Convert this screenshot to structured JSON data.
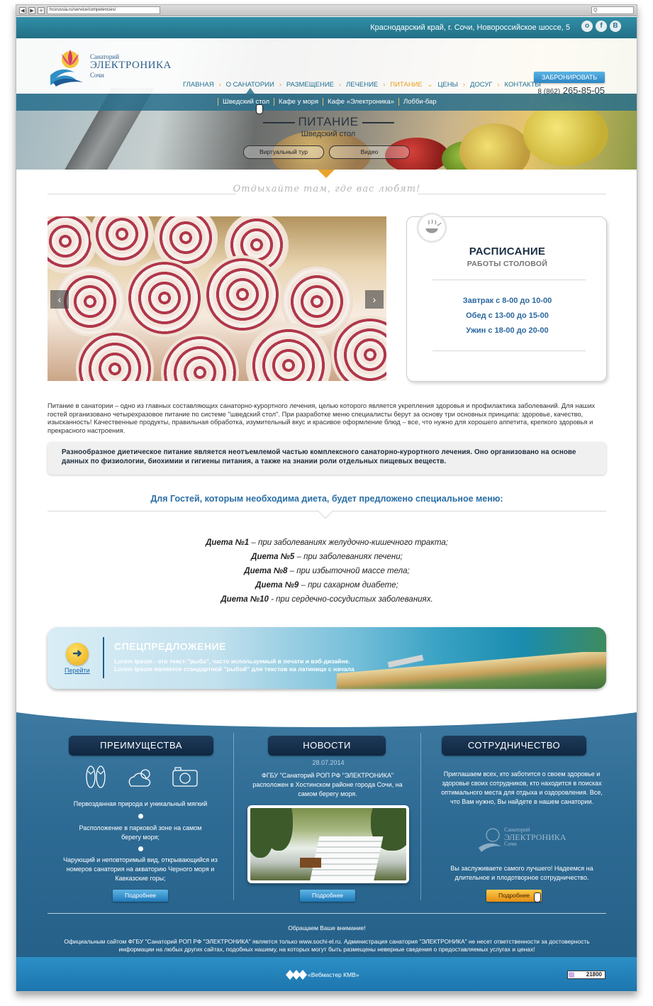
{
  "browser": {
    "url": "hcsrussia.ru/service/competencies/",
    "back_label": "◀",
    "forward_label": "▶",
    "reload_label": "+",
    "search_placeholder": "Q"
  },
  "topbar": {
    "address": "Краснодарский край, г. Сочи, Новороссийское шоссе, 5",
    "social": [
      "о",
      "f",
      "B"
    ]
  },
  "logo": {
    "line1": "Санаторий",
    "line2": "ЭЛЕКТРОНИКА",
    "line3": "Сочи"
  },
  "nav": {
    "items": [
      "ГЛАВНАЯ",
      "О САНАТОРИИ",
      "РАЗМЕЩЕНИЕ",
      "ЛЕЧЕНИЕ",
      "ПИТАНИЕ",
      "ЦЕНЫ",
      "ДОСУГ",
      "КОНТАКТЫ"
    ],
    "active": "ПИТАНИЕ",
    "book_label": "ЗАБРОНИРОВАТЬ",
    "phone_prefix": "8 (862)",
    "phone_number": "265-85-05"
  },
  "subnav": {
    "items": [
      "Шведский стол",
      "Кафе у моря",
      "Кафе «Электроника»",
      "Лобби-бар"
    ]
  },
  "hero": {
    "title": "ПИТАНИЕ",
    "subtitle": "Шведский стол",
    "btn_tour": "Виртуальный тур",
    "btn_video": "Видео"
  },
  "tagline": "Отдыхайте там, где вас любят!",
  "slider": {
    "prev_label": "‹",
    "next_label": "›"
  },
  "schedule": {
    "title": "РАСПИСАНИЕ",
    "subtitle": "РАБОТЫ СТОЛОВОЙ",
    "lines": [
      "Завтрак с 8-00 до 10-00",
      "Обед с 13-00 до 15-00",
      "Ужин с 18-00 до 20-00"
    ]
  },
  "intro": "Питание в санатории – одно из главных составляющих санаторно-курортного лечения, целью которого является укрепления здоровья и профилактика заболеваний. Для наших гостей организовано четырехразовое питание по системе \"шведский стол\". При разработке меню специалисты берут за основу три основных принципа: здоровье, качество, изысканность!  Качественные продукты, правильная обработка, изумительный вкус и красивое оформление блюд – все, что нужно для хорошего аппетита, крепкого здоровья и прекрасного настроения.",
  "highlight": "Разнообразное диетическое питание является неотъемлемой частью комплексного санаторно-курортного лечения. Оно организовано на основе данных по физиологии, биохимии и гигиены питания, а также на знании роли отдельных пищевых веществ.",
  "diet": {
    "heading": "Для Гостей, которым необходима диета, будет предложено специальное меню:",
    "items": [
      {
        "name": "Диета №1",
        "desc": " – при заболеваниях желудочно-кишечного тракта;"
      },
      {
        "name": "Диета №5",
        "desc": " – при заболеваниях печени;"
      },
      {
        "name": "Диета №8",
        "desc": " – при избыточной массе тела;"
      },
      {
        "name": "Диета №9",
        "desc": " – при сахарном диабете;"
      },
      {
        "name": "Диета №10",
        "desc": " -  при сердечно-сосудистых заболеваниях."
      }
    ]
  },
  "offer": {
    "title": "СПЕЦПРЕДЛОЖЕНИЕ",
    "link": "Перейти",
    "text1": "Lorem Ipsum - это текст-\"рыба\", часто используемый в печати и вэб-дизайне.",
    "text2": "Lorem Ipsum является стандартной \"рыбой\" для текстов на латинице с начала"
  },
  "advantages": {
    "title": "ПРЕИМУЩЕСТВА",
    "p1": "Первозданная природа и уникальный мягкий",
    "p2a": "Расположение в парковой зоне на самом",
    "p2b": "берегу моря;",
    "p3a": "Чарующий и неповторимый вид, открывающийся из",
    "p3b": "номеров санатория на акваторию Черного моря и",
    "p3c": "Кавказские горы;",
    "button": "Подробнее"
  },
  "news": {
    "title": "НОВОСТИ",
    "date": "28.07.2014",
    "line1": "ФГБУ \"Санаторий РОП РФ \"ЭЛЕКТРОНИКА\"",
    "line2": "расположен в Хостинском районе города Сочи, на",
    "line3": "самом берегу моря.",
    "button": "Подробнее"
  },
  "coop": {
    "title": "СОТРУДНИЧЕСТВО",
    "line1": "Приглашаем всех, кто заботится о своем здоровье и",
    "line2": "здоровье своих сотрудников, кто находится в поисках",
    "line3": "оптимального места для отдыха и оздоровления. Все,",
    "line4": "что Вам нужно, Вы найдете в нашем санатории.",
    "line5": "Вы заслуживаете самого лучшего! Надеемся на",
    "line6": "длительное и плодотворное сотрудничество.",
    "logo1": "Санаторий",
    "logo2": "ЭЛЕКТРОНИКА",
    "logo3": "Сочи",
    "button": "Подробнее"
  },
  "notice": {
    "line1": "Обращаем Ваше внимание!",
    "line2": "Официальным сайтом ФГБУ \"Санаторий РОП РФ \"ЭЛЕКТРОНИКА\" является только www.sochi-el.ru. Администрация санатория \"ЭЛЕКТРОНИКА\" не несет ответственности за достоверность",
    "line3": "информации на любых других сайтах, подобных нашему, на которых могут быть размещены неверные сведения о предоставляемых услугах и ценах!"
  },
  "bottom": {
    "webmaster": "«Вебмастер КМВ»",
    "counter": "21800"
  },
  "colors": {
    "accent_orange": "#e6a020",
    "brand_blue": "#1f6f93",
    "footer_blue": "#2e6b94"
  }
}
